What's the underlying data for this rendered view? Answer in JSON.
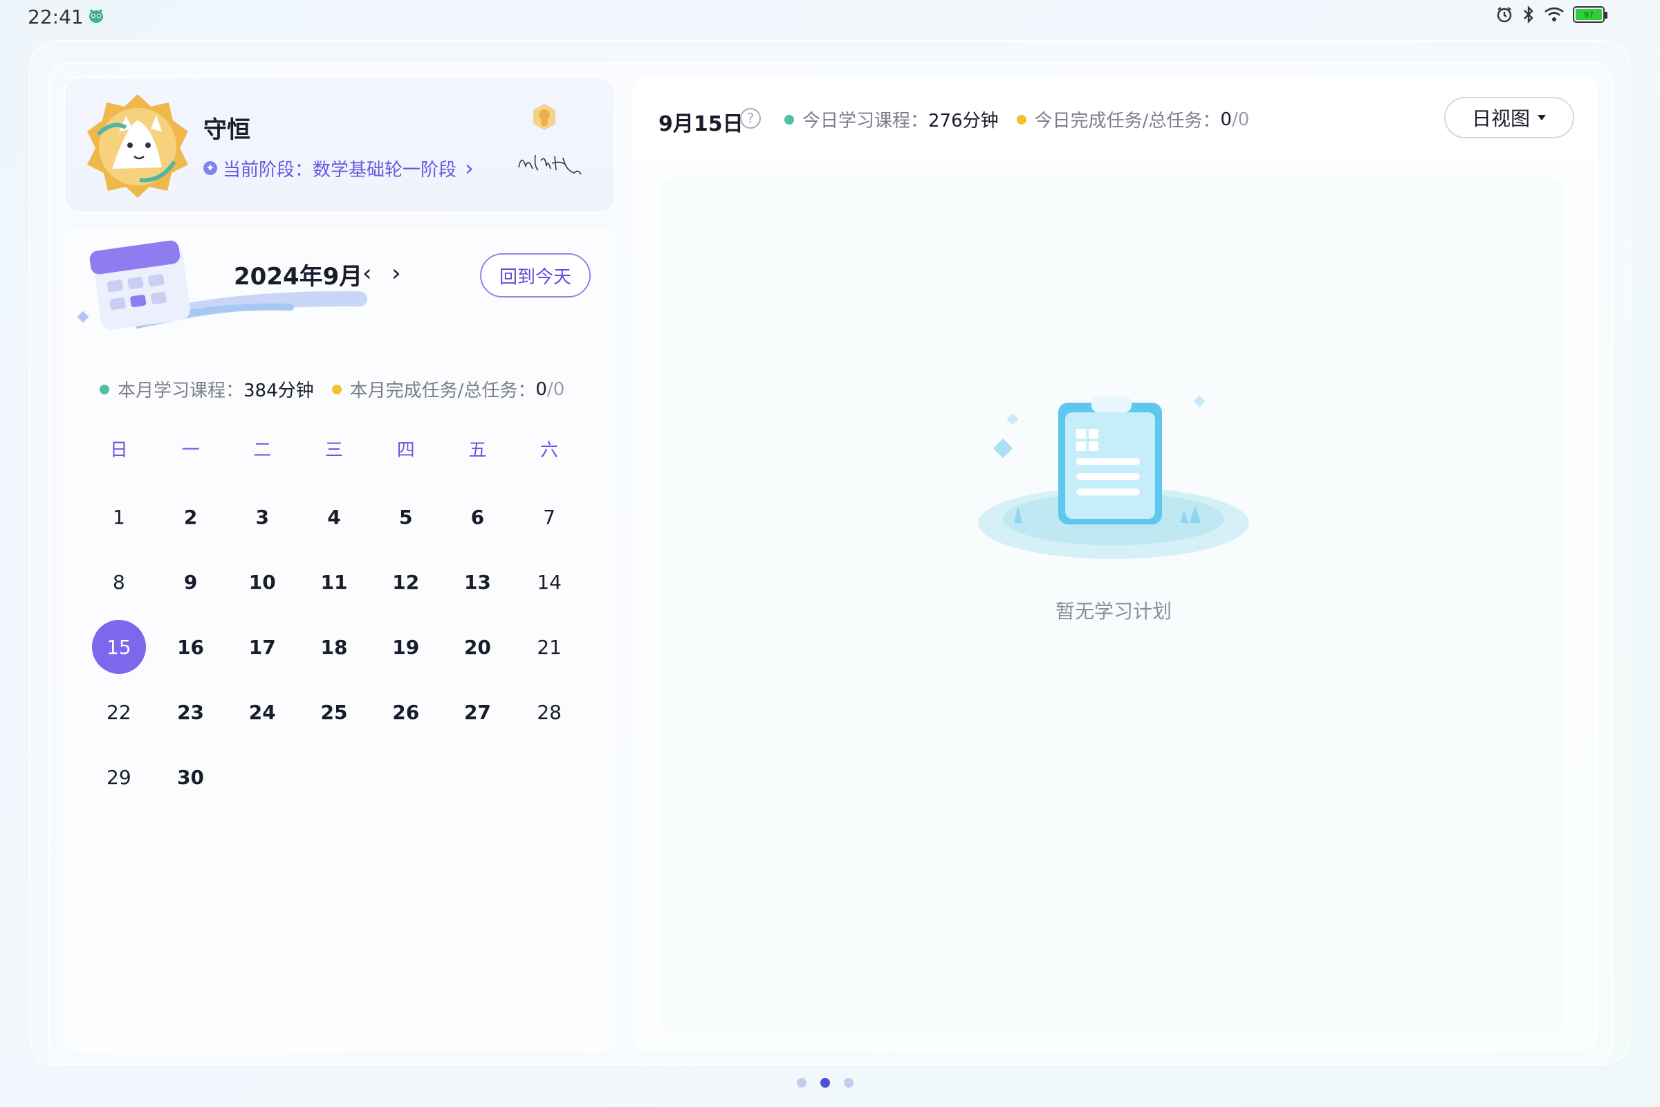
{
  "status_bar": {
    "time": "22:41",
    "battery": "97"
  },
  "profile": {
    "name": "守恒",
    "stage_label": "当前阶段：",
    "stage_value": "数学基础轮一阶段",
    "stage_arrow": "›"
  },
  "calendar": {
    "title": "2024年9月",
    "prev": "‹",
    "next": "›",
    "today_button": "回到今天",
    "month_course_label": "本月学习课程：",
    "month_course_value": "384分钟",
    "month_task_label": "本月完成任务/总任务：",
    "month_task_done": "0",
    "month_task_total": "/0",
    "weekdays": [
      "日",
      "一",
      "二",
      "三",
      "四",
      "五",
      "六"
    ],
    "days": [
      "1",
      "2",
      "3",
      "4",
      "5",
      "6",
      "7",
      "8",
      "9",
      "10",
      "11",
      "12",
      "13",
      "14",
      "15",
      "16",
      "17",
      "18",
      "19",
      "20",
      "21",
      "22",
      "23",
      "24",
      "25",
      "26",
      "27",
      "28",
      "29",
      "30"
    ],
    "selected_day": "15",
    "colors": {
      "accent": "#7d67ec",
      "course_dot": "#4fbfa5",
      "task_dot": "#f5c02c"
    }
  },
  "day_panel": {
    "date": "9月15日",
    "help_icon": "?",
    "today_course_label": "今日学习课程：",
    "today_course_value": "276分钟",
    "today_task_label": "今日完成任务/总任务：",
    "today_task_done": "0",
    "today_task_total": "/0",
    "view_button": "日视图",
    "empty_text": "暂无学习计划"
  },
  "pager": {
    "pages": 3,
    "active": 2
  }
}
